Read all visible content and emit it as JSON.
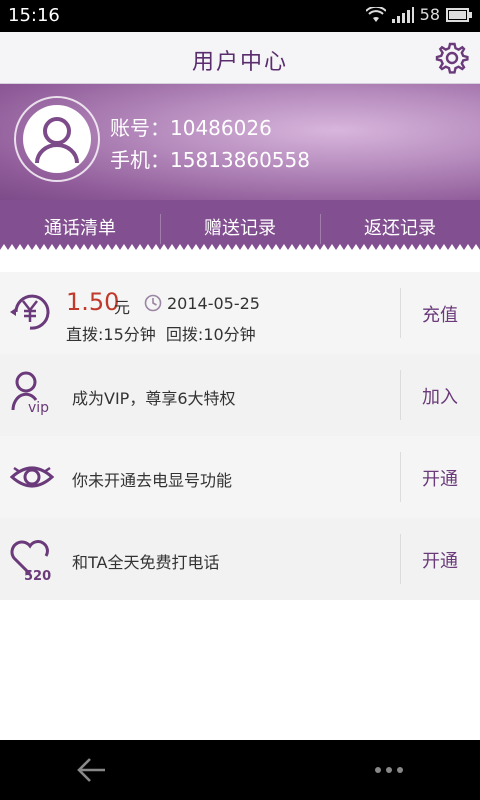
{
  "status_bar": {
    "time": "15:16",
    "battery": "58"
  },
  "header": {
    "title": "用户中心"
  },
  "profile": {
    "account": "账号：10486026",
    "phone": "手机：15813860558"
  },
  "tabs": [
    {
      "label": "通话清单"
    },
    {
      "label": "赠送记录"
    },
    {
      "label": "返还记录"
    }
  ],
  "balance": {
    "amount": "1.50",
    "unit": "元",
    "date": "2014-05-25",
    "minutes": "直拨:15分钟  回拨:10分钟",
    "action": "充值"
  },
  "rows": [
    {
      "text": "成为VIP，尊享6大特权",
      "action": "加入",
      "icon": "vip-icon"
    },
    {
      "text": "你未开通去电显号功能",
      "action": "开通",
      "icon": "eye-icon"
    },
    {
      "text": "和TA全天免费打电话",
      "action": "开通",
      "icon": "heart-520-icon"
    }
  ],
  "colors": {
    "accent": "#6a3a7a",
    "price": "#c0392b",
    "purple_bar": "#825090"
  }
}
